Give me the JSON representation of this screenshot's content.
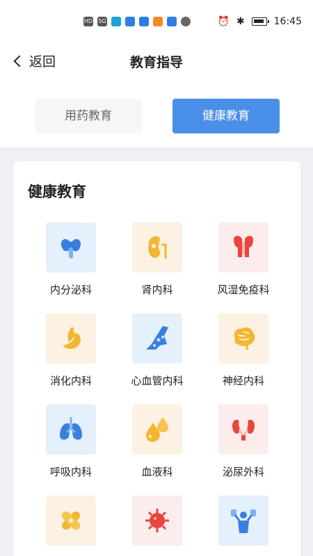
{
  "statusbar": {
    "time": "16:45",
    "network": "HD",
    "signal": "5G"
  },
  "nav": {
    "back_label": "返回",
    "title": "教育指导"
  },
  "tabs": [
    {
      "label": "用药教育",
      "active": false
    },
    {
      "label": "健康教育",
      "active": true
    }
  ],
  "section": {
    "title": "健康教育",
    "items": [
      {
        "label": "内分泌科",
        "icon": "thyroid-icon",
        "tile_color": "blue"
      },
      {
        "label": "肾内科",
        "icon": "kidney-icon",
        "tile_color": "orange"
      },
      {
        "label": "风湿免疫科",
        "icon": "joint-icon",
        "tile_color": "pink"
      },
      {
        "label": "消化内科",
        "icon": "stomach-icon",
        "tile_color": "orange"
      },
      {
        "label": "心血管内科",
        "icon": "blood-vessel-icon",
        "tile_color": "blue"
      },
      {
        "label": "神经内科",
        "icon": "brain-icon",
        "tile_color": "orange"
      },
      {
        "label": "呼吸内科",
        "icon": "lungs-icon",
        "tile_color": "blue"
      },
      {
        "label": "血液科",
        "icon": "blood-drops-icon",
        "tile_color": "orange"
      },
      {
        "label": "泌尿外科",
        "icon": "urinary-icon",
        "tile_color": "pink"
      },
      {
        "label": "",
        "icon": "bandage-icon",
        "tile_color": "orange"
      },
      {
        "label": "",
        "icon": "virus-icon",
        "tile_color": "pink"
      },
      {
        "label": "",
        "icon": "fitness-icon",
        "tile_color": "blue"
      }
    ]
  }
}
